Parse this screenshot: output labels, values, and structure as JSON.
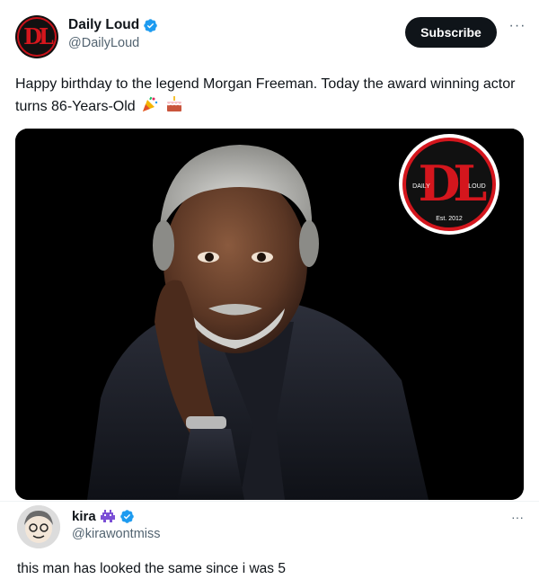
{
  "tweet": {
    "author": {
      "display_name": "Daily Loud",
      "handle": "@DailyLoud",
      "verified": true,
      "avatar_icon": "daily-loud-logo"
    },
    "subscribe_label": "Subscribe",
    "more_label": "···",
    "text": "Happy birthday to the legend Morgan Freeman. Today the award winning actor turns 86-Years-Old",
    "emojis": [
      "party-popper-icon",
      "birthday-cake-icon"
    ],
    "media": {
      "logo": {
        "left_text": "DAILY",
        "right_text": "LOUD",
        "est_text": "Est. 2012",
        "monogram": "DL"
      }
    }
  },
  "reply": {
    "display_name": "kira",
    "handle": "@kirawontmiss",
    "verified": true,
    "badge_icon": "alien-monster-icon",
    "more_label": "···",
    "text": "this man has looked the same since i was 5"
  },
  "colors": {
    "brand_red": "#d4161d",
    "verified_blue": "#1d9bf0",
    "text_primary": "#0f1419",
    "text_secondary": "#536471"
  }
}
